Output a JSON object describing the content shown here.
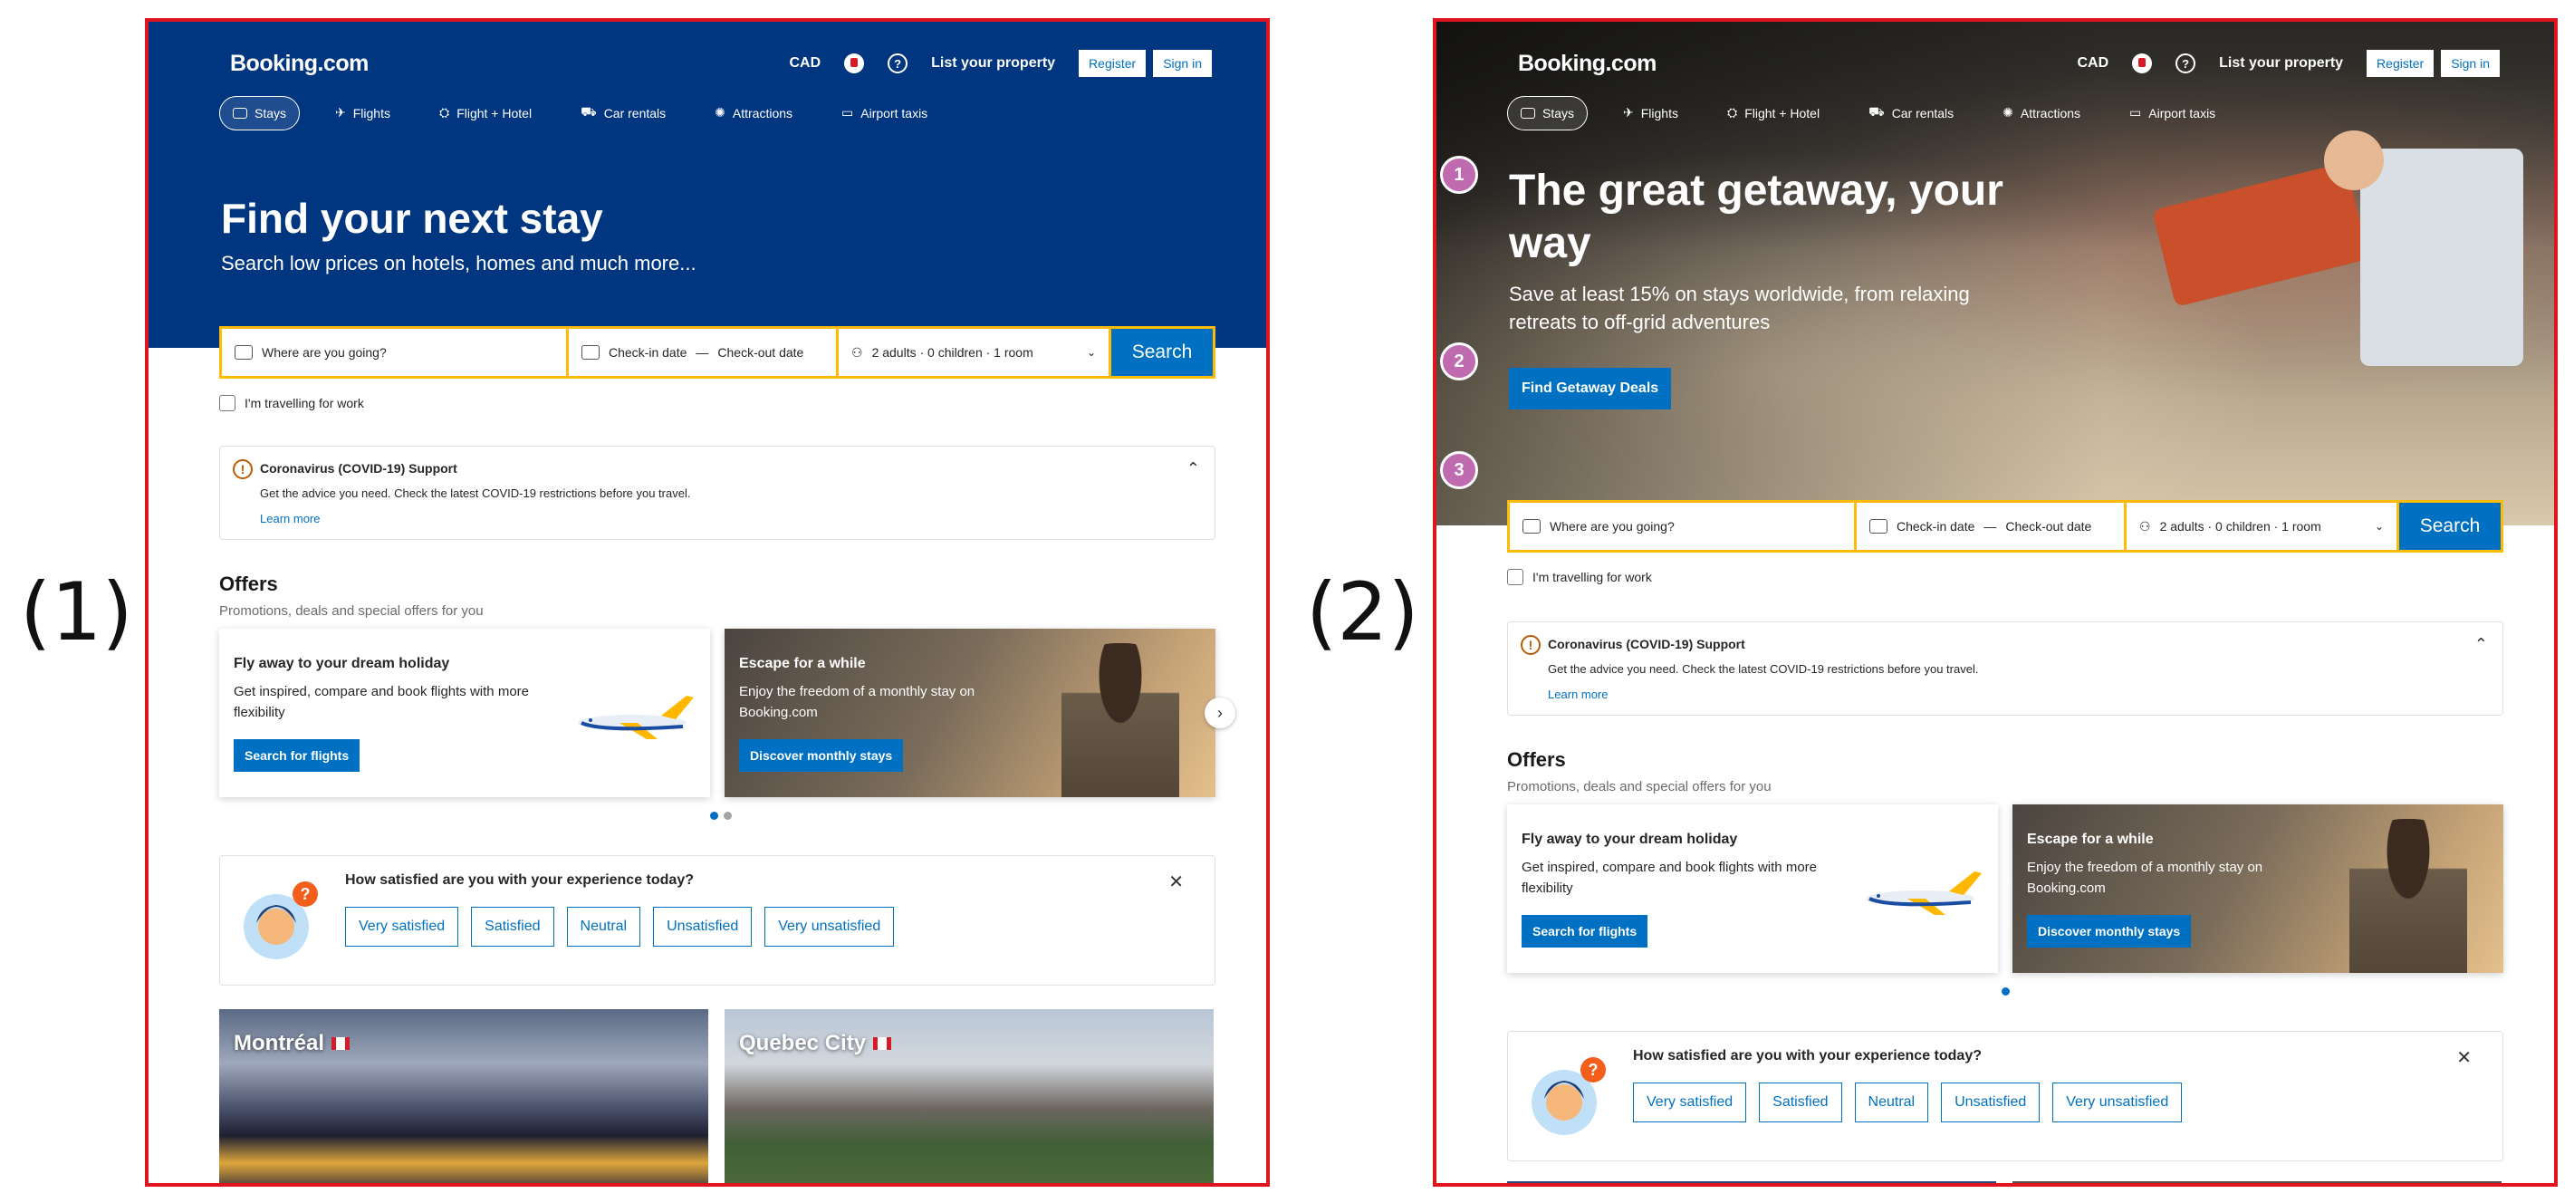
{
  "panel_labels": [
    "(1)",
    "(2)"
  ],
  "header": {
    "logo": "Booking.com",
    "currency": "CAD",
    "help": "?",
    "list_property": "List your property",
    "register": "Register",
    "sign_in": "Sign in"
  },
  "nav": [
    "Stays",
    "Flights",
    "Flight + Hotel",
    "Car rentals",
    "Attractions",
    "Airport taxis"
  ],
  "panel1": {
    "title": "Find your next stay",
    "subtitle": "Search low prices on hotels, homes and much more..."
  },
  "panel2": {
    "title_line1": "The great getaway, your",
    "title_line2": "way",
    "subtitle_line1": "Save at least 15% on stays worldwide, from relaxing",
    "subtitle_line2": "retreats to off-grid adventures",
    "cta": "Find Getaway Deals",
    "steps": [
      "1",
      "2",
      "3"
    ]
  },
  "search": {
    "destination_placeholder": "Where are you going?",
    "checkin": "Check-in date",
    "dash": "—",
    "checkout": "Check-out date",
    "guests": "2 adults · 0 children · 1 room",
    "button": "Search"
  },
  "work_travel": "I'm travelling for work",
  "covid": {
    "title": "Coronavirus (COVID-19) Support",
    "desc": "Get the advice you need. Check the latest COVID-19 restrictions before you travel.",
    "link": "Learn more"
  },
  "offers": {
    "title": "Offers",
    "subtitle": "Promotions, deals and special offers for you",
    "cards": [
      {
        "title": "Fly away to your dream holiday",
        "desc": "Get inspired, compare and book flights with more flexibility",
        "button": "Search for flights"
      },
      {
        "title": "Escape for a while",
        "desc": "Enjoy the freedom of a monthly stay on Booking.com",
        "button": "Discover monthly stays"
      }
    ]
  },
  "survey": {
    "question": "How satisfied are you with your experience today?",
    "options": [
      "Very satisfied",
      "Satisfied",
      "Neutral",
      "Unsatisfied",
      "Very unsatisfied"
    ]
  },
  "cities": [
    "Montréal",
    "Quebec City"
  ],
  "colors": {
    "brand_blue": "#003580",
    "action_blue": "#0071c2",
    "search_yellow": "#febb02",
    "frame_red": "#e0141e"
  }
}
